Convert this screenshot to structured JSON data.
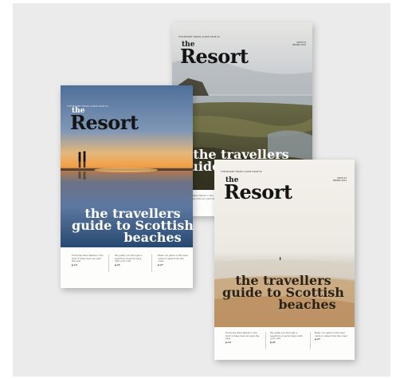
{
  "magazines": [
    {
      "id": "left",
      "header_left": "THE RESORT TRAVEL GUIDE ISSUE 04",
      "header_right": [
        "",
        ""
      ],
      "the": "the",
      "title": "Resort",
      "headline": [
        "the travellers",
        "guide to Scottish",
        "beaches"
      ],
      "footer": [
        {
          "text": "From the West Sands to the Gulf of Islay, here we pick the best",
          "page": "p.12"
        },
        {
          "text": "We guide you through a selection of secret bays with your own",
          "page": "p.21"
        },
        {
          "text": "Read our guide to the best outdoor cafes from the coast",
          "page": "p.27"
        }
      ]
    },
    {
      "id": "back",
      "header_left": "THE RESORT TRAVEL GUIDE ISSUE 04",
      "header_right": [
        "ISSUE 04",
        "SPRING 2014"
      ],
      "the": "the",
      "title": "Resort",
      "headline": [
        "the travellers",
        "guide to Scottish"
      ],
      "footer": [
        {
          "text": "From the West Sands to the Gulf of Islay, here we pick the best",
          "page": "p.12"
        }
      ]
    },
    {
      "id": "front",
      "header_left": "THE RESORT TRAVEL GUIDE ISSUE 04",
      "header_right": [
        "ISSUE 04",
        "SPRING 2014"
      ],
      "the": "the",
      "title": "Resort",
      "headline": [
        "the travellers",
        "guide to Scottish",
        "beaches"
      ],
      "footer": [
        {
          "text": "From the West Sands to the Gulf of Islay, here we pick the best",
          "page": "p.12"
        },
        {
          "text": "We guide you through a selection of secret bays with your own",
          "page": "p.21"
        },
        {
          "text": "Read our guide to the best outdoor cafes from the coast",
          "page": "p.27"
        }
      ]
    }
  ],
  "colors": {
    "backdrop": "#ebebeb",
    "sunset_sky_top": "#5d7ea5",
    "sunset_glow": "#f2a64a",
    "headline_on_photo": "#ffffff",
    "headline_on_sand": "#2a2216"
  }
}
